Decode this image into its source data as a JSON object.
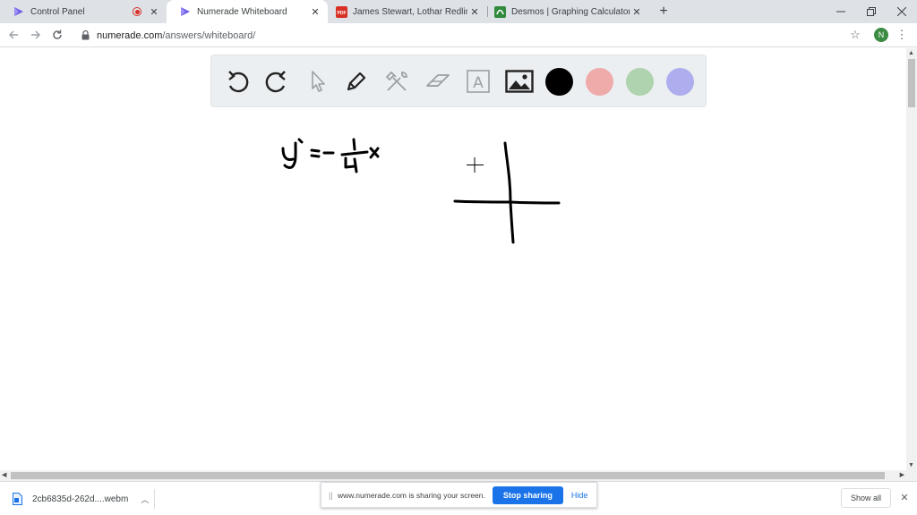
{
  "tabs": [
    {
      "title": "Control Panel",
      "icon": "numerade-logo-icon",
      "recording": true
    },
    {
      "title": "Numerade Whiteboard",
      "icon": "numerade-logo-icon",
      "active": true
    },
    {
      "title": "James Stewart, Lothar Redlin, Sal",
      "icon": "pdf-icon"
    },
    {
      "title": "Desmos | Graphing Calculator",
      "icon": "desmos-logo-icon"
    }
  ],
  "address_bar": {
    "host": "numerade.com",
    "path": "/answers/whiteboard/"
  },
  "profile_initial": "N",
  "whiteboard": {
    "tools": [
      "undo",
      "redo",
      "select",
      "pen",
      "tools",
      "eraser",
      "text",
      "image"
    ],
    "text_tool_glyph": "A",
    "colors": [
      "#000000",
      "#efaaaa",
      "#aed3ae",
      "#aeaeee"
    ],
    "handwritten_equation": "y = - 1/4 x"
  },
  "downloads": {
    "filename": "2cb6835d-262d....webm",
    "show_all": "Show all"
  },
  "screen_share": {
    "message": "www.numerade.com is sharing your screen.",
    "stop": "Stop sharing",
    "hide": "Hide"
  }
}
